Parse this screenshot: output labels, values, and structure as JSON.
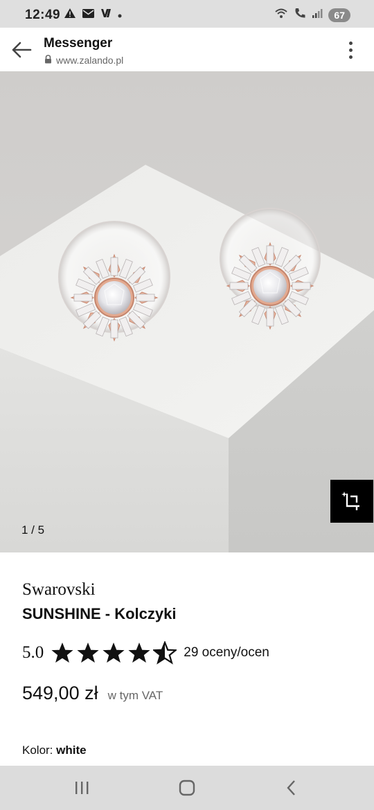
{
  "status_bar": {
    "time": "12:49",
    "battery": "67",
    "icons": [
      "warning-icon",
      "mail-icon",
      "v-app-icon",
      "dot-icon",
      "wifi-icon",
      "wifi-call-icon",
      "signal-icon"
    ]
  },
  "browser": {
    "title": "Messenger",
    "url": "www.zalando.pl"
  },
  "gallery": {
    "counter": "1 / 5"
  },
  "product": {
    "brand": "Swarovski",
    "name": "SUNSHINE - Kolczyki",
    "rating_value": "5.0",
    "rating_stars": 4.5,
    "rating_count": "29 oceny/ocen",
    "price": "549,00 zł",
    "vat_note": "w tym VAT",
    "color_label": "Kolor:",
    "color_value": "white"
  },
  "colors": {
    "status_bar_bg": "#dfdfdf",
    "nav_bar_bg": "#dcdcdc",
    "image_bg": "#d3d2d0",
    "accent": "#000000"
  }
}
